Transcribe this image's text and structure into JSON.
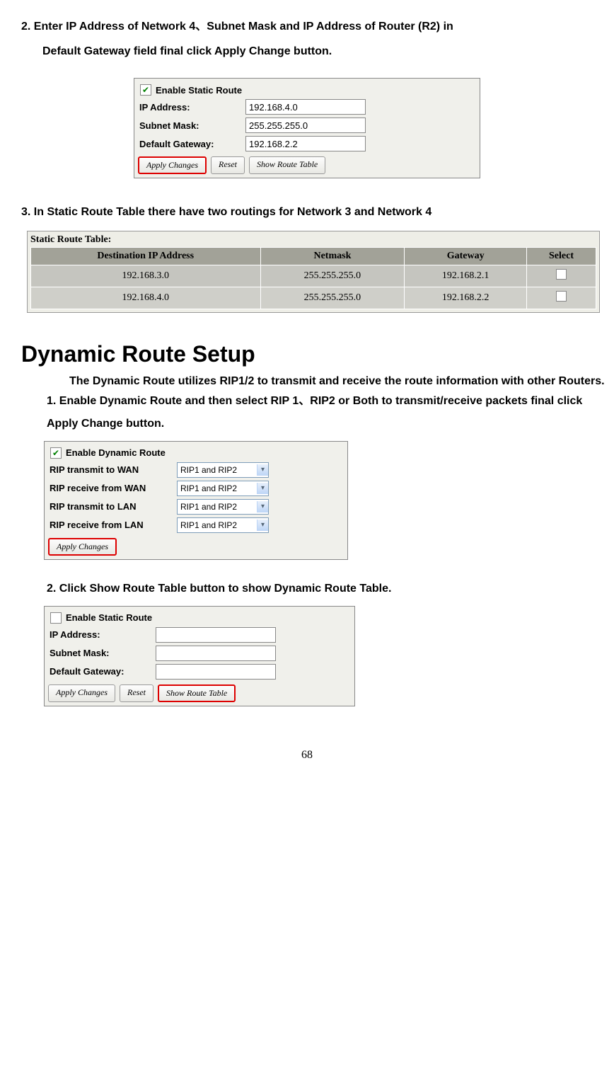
{
  "steps": {
    "step2": "2.  Enter IP Address of Network 4、Subnet Mask and IP Address of Router (R2) in",
    "step2b": "Default Gateway field final click Apply Change button.",
    "step3": "3.  In Static Route Table there have two routings for Network 3 and Network 4"
  },
  "static_form": {
    "enable_label": "Enable Static Route",
    "ip_label": "IP Address:",
    "ip_value": "192.168.4.0",
    "mask_label": "Subnet Mask:",
    "mask_value": "255.255.255.0",
    "gw_label": "Default Gateway:",
    "gw_value": "192.168.2.2",
    "apply_btn": "Apply Changes",
    "reset_btn": "Reset",
    "show_btn": "Show Route Table"
  },
  "route_table": {
    "title": "Static Route Table:",
    "headers": {
      "dest": "Destination IP Address",
      "mask": "Netmask",
      "gw": "Gateway",
      "sel": "Select"
    },
    "rows": [
      {
        "dest": "192.168.3.0",
        "mask": "255.255.255.0",
        "gw": "192.168.2.1"
      },
      {
        "dest": "192.168.4.0",
        "mask": "255.255.255.0",
        "gw": "192.168.2.2"
      }
    ]
  },
  "dyn_heading": "Dynamic Route Setup",
  "dyn_para": "The Dynamic Route utilizes RIP1/2 to transmit and receive the route information with other Routers.",
  "dyn_step1": "1.  Enable Dynamic Route and then select RIP 1、RIP2 or Both to transmit/receive packets final click Apply Change button.",
  "dyn_form": {
    "enable_label": "Enable Dynamic Route",
    "r1_label": "RIP transmit to WAN",
    "r2_label": "RIP receive from WAN",
    "r3_label": "RIP transmit to LAN",
    "r4_label": "RIP receive from LAN",
    "sel_value": "RIP1 and RIP2",
    "apply_btn": "Apply Changes"
  },
  "dyn_step2": "2.  Click Show Route Table button to show Dynamic Route Table.",
  "static_form2": {
    "enable_label": "Enable Static Route",
    "ip_label": "IP Address:",
    "mask_label": "Subnet Mask:",
    "gw_label": "Default Gateway:",
    "apply_btn": "Apply Changes",
    "reset_btn": "Reset",
    "show_btn": "Show Route Table"
  },
  "page_num": "68"
}
